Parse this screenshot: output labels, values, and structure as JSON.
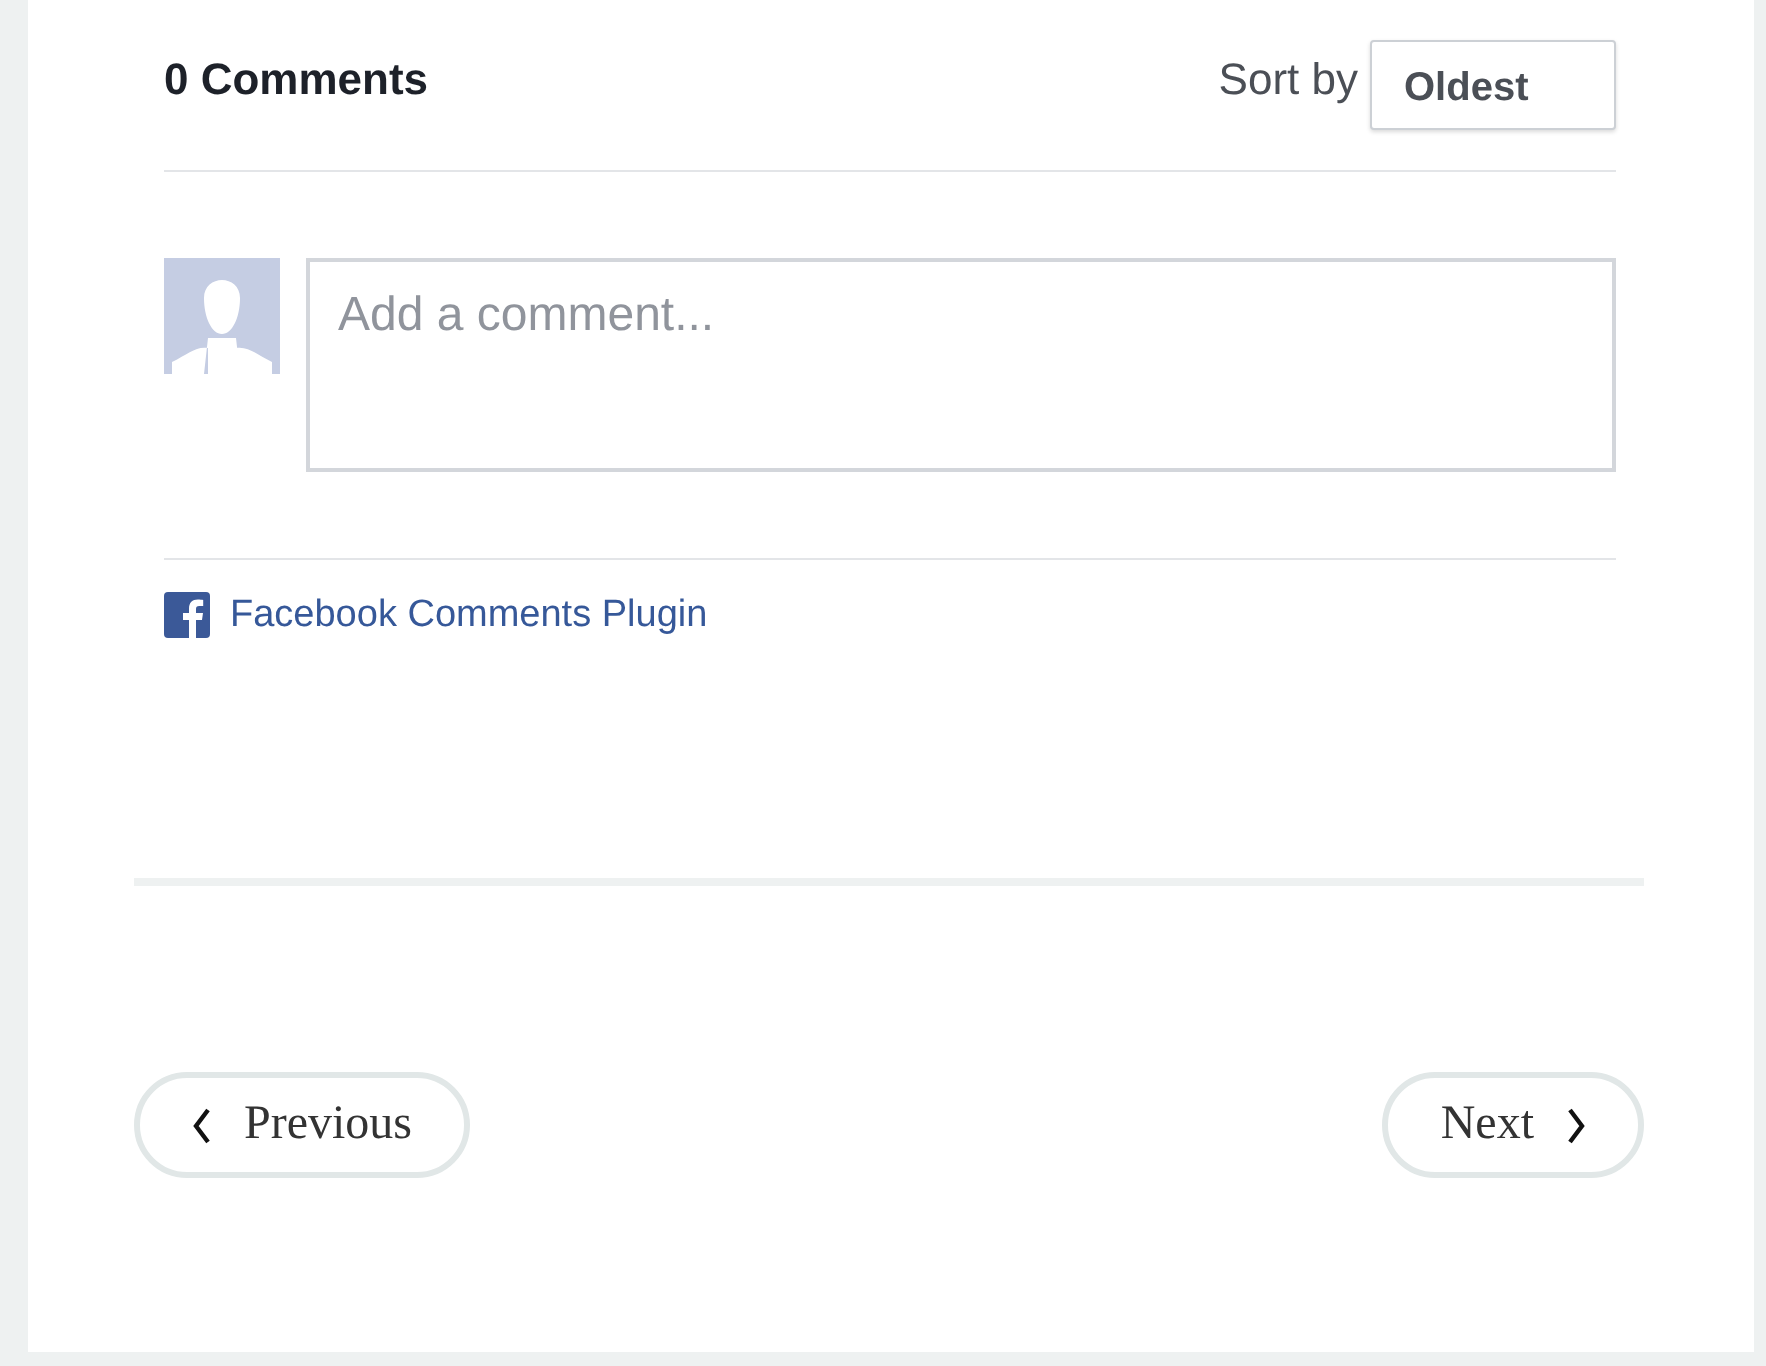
{
  "comments": {
    "count_label": "0 Comments",
    "sort_label": "Sort by",
    "sort_value": "Oldest",
    "placeholder": "Add a comment...",
    "plugin_link": "Facebook Comments Plugin"
  },
  "pagination": {
    "previous": "Previous",
    "next": "Next"
  }
}
